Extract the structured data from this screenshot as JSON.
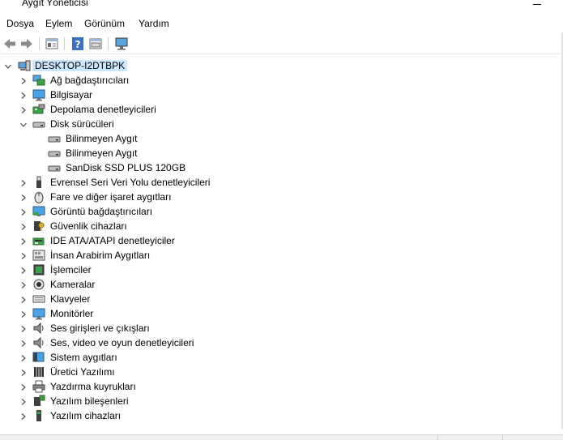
{
  "window": {
    "title": "Aygıt Yöneticisi"
  },
  "menu": [
    "Dosya",
    "Eylem",
    "Görünüm",
    "Yardım"
  ],
  "toolbar": {
    "buttons": [
      "back-arrow-icon",
      "forward-arrow-icon",
      "properties-icon",
      "help-icon",
      "view-icon",
      "monitor-scan-icon"
    ]
  },
  "tree": {
    "root": "DESKTOP-I2DTBPK",
    "categories": [
      {
        "label": "Ağ bağdaştırıcıları",
        "icon": "network-adapter-icon"
      },
      {
        "label": "Bilgisayar",
        "icon": "computer-icon"
      },
      {
        "label": "Depolama denetleyicileri",
        "icon": "storage-controller-icon"
      },
      {
        "label": "Disk sürücüleri",
        "icon": "disk-drive-icon",
        "expanded": true,
        "children": [
          "Bilinmeyen Aygıt",
          "Bilinmeyen Aygıt",
          "SanDisk SSD PLUS 120GB"
        ]
      },
      {
        "label": "Evrensel Seri Veri Yolu denetleyicileri",
        "icon": "usb-icon"
      },
      {
        "label": "Fare ve diğer işaret aygıtları",
        "icon": "mouse-icon"
      },
      {
        "label": "Görüntü bağdaştırıcıları",
        "icon": "display-adapter-icon"
      },
      {
        "label": "Güvenlik cihazları",
        "icon": "security-device-icon"
      },
      {
        "label": "IDE ATA/ATAPI denetleyiciler",
        "icon": "ide-controller-icon"
      },
      {
        "label": "İnsan Arabirim Aygıtları",
        "icon": "hid-icon"
      },
      {
        "label": "İşlemciler",
        "icon": "processor-icon"
      },
      {
        "label": "Kameralar",
        "icon": "camera-icon"
      },
      {
        "label": "Klavyeler",
        "icon": "keyboard-icon"
      },
      {
        "label": "Monitörler",
        "icon": "monitor-icon"
      },
      {
        "label": "Ses girişleri ve çıkışları",
        "icon": "speaker-icon"
      },
      {
        "label": "Ses, video ve oyun denetleyicileri",
        "icon": "sound-controller-icon"
      },
      {
        "label": "Sistem aygıtları",
        "icon": "system-device-icon"
      },
      {
        "label": "Üretici Yazılımı",
        "icon": "firmware-icon"
      },
      {
        "label": "Yazdırma kuyrukları",
        "icon": "printer-icon"
      },
      {
        "label": "Yazılım bileşenleri",
        "icon": "software-component-icon"
      },
      {
        "label": "Yazılım cihazları",
        "icon": "software-device-icon"
      }
    ]
  }
}
